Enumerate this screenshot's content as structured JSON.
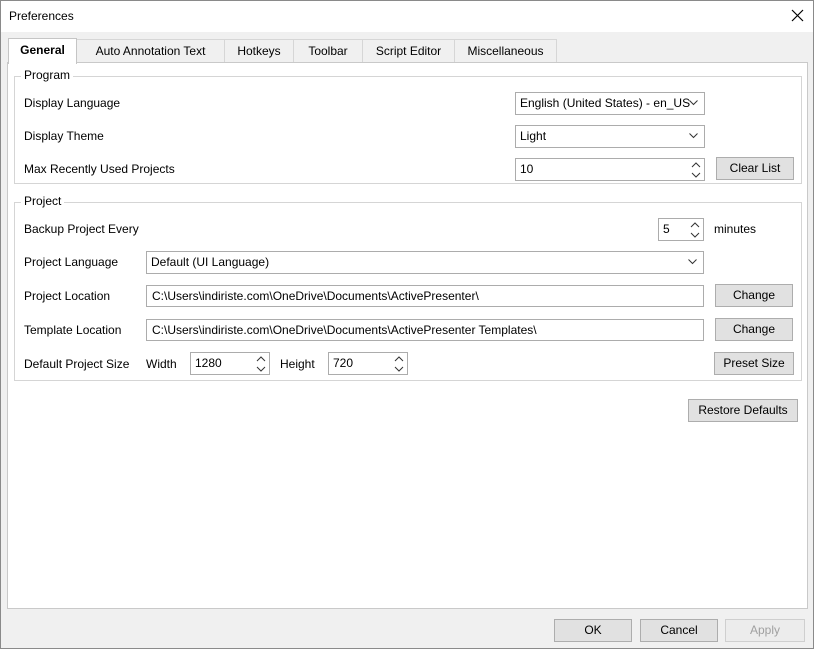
{
  "window": {
    "title": "Preferences",
    "close_icon": "close-icon"
  },
  "tabs": [
    {
      "label": "General"
    },
    {
      "label": "Auto Annotation Text"
    },
    {
      "label": "Hotkeys"
    },
    {
      "label": "Toolbar"
    },
    {
      "label": "Script Editor"
    },
    {
      "label": "Miscellaneous"
    }
  ],
  "program": {
    "title": "Program",
    "display_language_label": "Display Language",
    "display_language_value": "English (United States) - en_US",
    "display_theme_label": "Display Theme",
    "display_theme_value": "Light",
    "max_recent_label": "Max Recently Used Projects",
    "max_recent_value": "10",
    "clear_list_label": "Clear List"
  },
  "project": {
    "title": "Project",
    "backup_label": "Backup Project Every",
    "backup_value": "5",
    "backup_unit": "minutes",
    "language_label": "Project Language",
    "language_value": "Default (UI Language)",
    "location_label": "Project Location",
    "location_value": "C:\\Users\\indiriste.com\\OneDrive\\Documents\\ActivePresenter\\",
    "location_change": "Change",
    "template_label": "Template Location",
    "template_value": "C:\\Users\\indiriste.com\\OneDrive\\Documents\\ActivePresenter Templates\\",
    "template_change": "Change",
    "size_label": "Default Project Size",
    "width_label": "Width",
    "width_value": "1280",
    "height_label": "Height",
    "height_value": "720",
    "preset_label": "Preset Size"
  },
  "restore_defaults_label": "Restore Defaults",
  "footer": {
    "ok": "OK",
    "cancel": "Cancel",
    "apply": "Apply"
  }
}
